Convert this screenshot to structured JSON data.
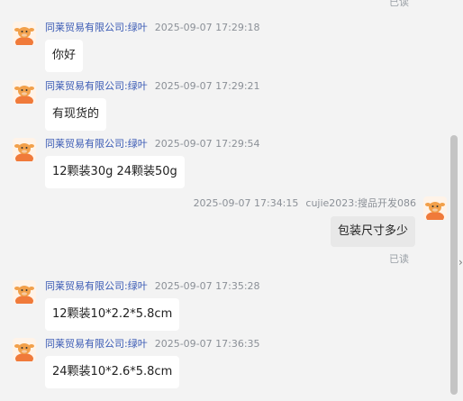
{
  "chat": {
    "top_status": "已读",
    "messages": [
      {
        "sender": "同莱贸易有限公司:绿叶",
        "time": "2025-09-07 17:29:18",
        "text": "你好"
      },
      {
        "sender": "同莱贸易有限公司:绿叶",
        "time": "2025-09-07 17:29:21",
        "text": "有现货的"
      },
      {
        "sender": "同莱贸易有限公司:绿叶",
        "time": "2025-09-07 17:29:54",
        "text": "12颗装30g  24颗装50g"
      },
      {
        "sender": "同莱贸易有限公司:绿叶",
        "time": "2025-09-07 17:35:28",
        "text": "12颗装10*2.2*5.8cm"
      },
      {
        "sender": "同莱贸易有限公司:绿叶",
        "time": "2025-09-07 17:36:35",
        "text": "24颗装10*2.6*5.8cm"
      }
    ],
    "outgoing": {
      "time": "2025-09-07 17:34:15",
      "sender": "cujie2023:搜品开发086",
      "text": "包装尺寸多少",
      "status": "已读"
    }
  },
  "colors": {
    "background": "#f3f3f3",
    "sender": "#3b5bb5",
    "time": "#8b9097",
    "incoming_bubble": "#ffffff",
    "outgoing_bubble": "#e8e8e8",
    "avatar_orange": "#f07a3a"
  },
  "icons": {
    "avatar": "cartoon-cow-avatar",
    "edge": "chevron-right-icon"
  }
}
